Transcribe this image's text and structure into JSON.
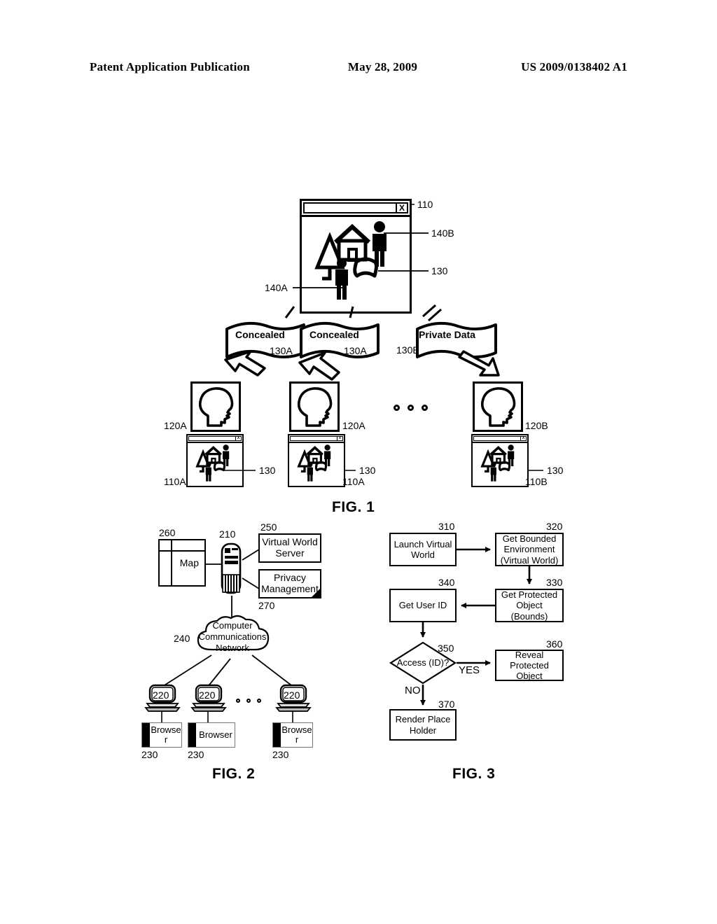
{
  "header": {
    "publication": "Patent Application Publication",
    "date": "May 28, 2009",
    "number": "US 2009/0138402 A1"
  },
  "fig1": {
    "caption": "FIG. 1",
    "close_button": "X",
    "main_window_ref": "110",
    "avatar_b_ref": "140B",
    "flag_ref": "130",
    "avatar_a_ref": "140A",
    "banners": [
      {
        "label": "Concealed",
        "ref": "130A"
      },
      {
        "label": "Concealed",
        "ref": "130A"
      },
      {
        "label": "Private Data",
        "ref": "130B"
      }
    ],
    "clients": [
      {
        "head_ref": "120A",
        "window_ref": "110A",
        "flag_ref": "130"
      },
      {
        "head_ref": "120A",
        "window_ref": "110A",
        "flag_ref": "130"
      },
      {
        "head_ref": "120B",
        "window_ref": "110B",
        "flag_ref": "130"
      }
    ]
  },
  "fig2": {
    "caption": "FIG. 2",
    "map": {
      "label": "Map",
      "ref": "260"
    },
    "server": {
      "ref": "210"
    },
    "virtual_world_server": {
      "label": "Virtual World Server",
      "ref": "250"
    },
    "privacy_management": {
      "label": "Privacy Management",
      "ref": "270"
    },
    "network": {
      "label": "Computer Communications Network",
      "ref": "240"
    },
    "clients": [
      {
        "terminal_ref": "220",
        "browser_label": "Browse r",
        "browser_ref": "230"
      },
      {
        "terminal_ref": "220",
        "browser_label": "Browser",
        "browser_ref": "230"
      },
      {
        "terminal_ref": "220",
        "browser_label": "Browse r",
        "browser_ref": "230"
      }
    ]
  },
  "fig3": {
    "caption": "FIG. 3",
    "nodes": [
      {
        "label": "Launch Virtual World",
        "ref": "310"
      },
      {
        "label": "Get Bounded Environment (Virtual World)",
        "ref": "320"
      },
      {
        "label": "Get Protected Object (Bounds)",
        "ref": "330"
      },
      {
        "label": "Get User ID",
        "ref": "340"
      },
      {
        "label": "Access (ID)?",
        "ref": "350"
      },
      {
        "label": "Reveal Protected Object",
        "ref": "360"
      },
      {
        "label": "Render Place Holder",
        "ref": "370"
      }
    ],
    "edge_yes": "YES",
    "edge_no": "NO"
  }
}
